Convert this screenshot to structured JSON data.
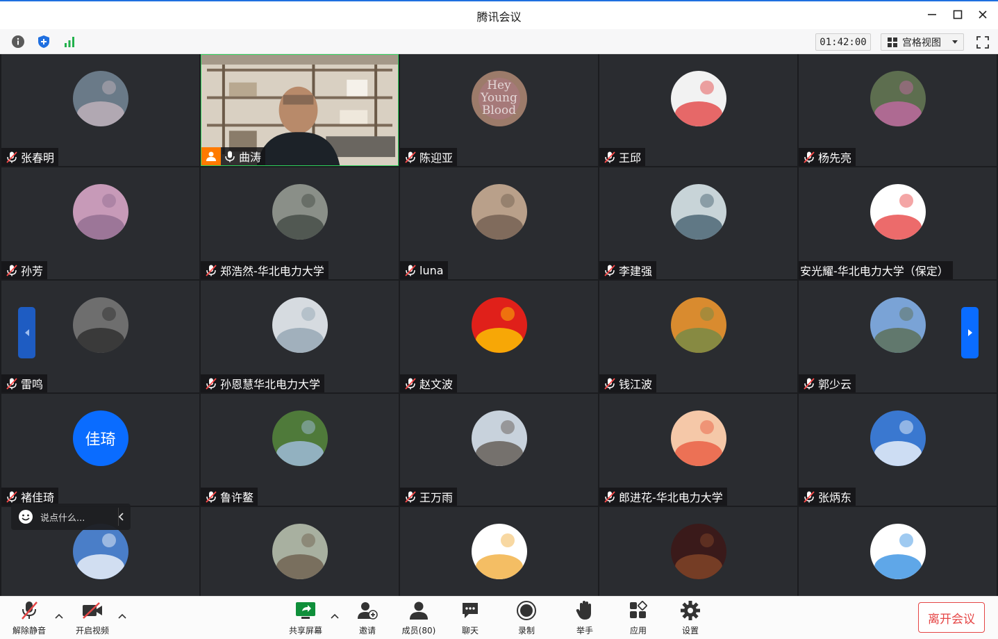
{
  "window": {
    "title": "腾讯会议"
  },
  "infobar": {
    "timer": "01:42:00",
    "view_mode": "宫格视图"
  },
  "participants": [
    {
      "name": "张春明",
      "avatar_bg": "#6a7a88",
      "avatar_accent": "#c9b8c0"
    },
    {
      "name": "曲涛",
      "video": true,
      "host": true
    },
    {
      "name": "陈迎亚",
      "avatar_bg": "#9c7b6a",
      "avatar_text": "Hey Young Blood"
    },
    {
      "name": "王邱",
      "avatar_bg": "#f2f2f2",
      "avatar_accent": "#e23a3a"
    },
    {
      "name": "杨先亮",
      "avatar_bg": "#5d6e4f",
      "avatar_accent": "#c96aa8"
    },
    {
      "name": "孙芳",
      "avatar_bg": "#c79ab8",
      "avatar_accent": "#8e6a8e"
    },
    {
      "name": "郑浩然-华北电力大学",
      "avatar_bg": "#8a8f88",
      "avatar_accent": "#3d4640"
    },
    {
      "name": "luna",
      "avatar_bg": "#b9a08a",
      "avatar_accent": "#6d5a4c"
    },
    {
      "name": "李建强",
      "avatar_bg": "#c8d4d8",
      "avatar_accent": "#3d5a6a"
    },
    {
      "name": "安光耀-华北电力大学（保定）",
      "avatar_bg": "#ffffff",
      "avatar_accent": "#e63a3a",
      "no_mic": true
    },
    {
      "name": "雷鸣",
      "avatar_bg": "#6e6e6e",
      "avatar_accent": "#2a2a2a"
    },
    {
      "name": "孙恩慧华北电力大学",
      "avatar_bg": "#d6dbe0",
      "avatar_accent": "#8fa2b0"
    },
    {
      "name": "赵文波",
      "avatar_bg": "#e0201a",
      "avatar_accent": "#ffd400"
    },
    {
      "name": "钱江波",
      "avatar_bg": "#d98b2f",
      "avatar_accent": "#6b8a4a"
    },
    {
      "name": "郭少云",
      "avatar_bg": "#7aa3d6",
      "avatar_accent": "#5a6a4a"
    },
    {
      "name": "褚佳琦",
      "avatar_label": "佳琦"
    },
    {
      "name": "鲁许鳌",
      "avatar_bg": "#4f7a3a",
      "avatar_accent": "#a8c4ee"
    },
    {
      "name": "王万雨",
      "avatar_bg": "#c8d2dc",
      "avatar_accent": "#5a5048"
    },
    {
      "name": "郎进花-华北电力大学",
      "avatar_bg": "#f5c8a8",
      "avatar_accent": "#e8543a"
    },
    {
      "name": "张炳东",
      "avatar_bg": "#3a78d0",
      "avatar_accent": "#ffffff"
    },
    {
      "name": "",
      "avatar_bg": "#4a7ec8",
      "avatar_accent": "#ffffff",
      "hidden_name": true
    },
    {
      "name": "",
      "avatar_bg": "#a8b0a0",
      "avatar_accent": "#6a5a48",
      "hidden_name": true
    },
    {
      "name": "",
      "avatar_bg": "#ffffff",
      "avatar_accent": "#f0a830",
      "hidden_name": true
    },
    {
      "name": "",
      "avatar_bg": "#3a1a1a",
      "avatar_accent": "#8a4a2a",
      "hidden_name": true
    },
    {
      "name": "",
      "avatar_bg": "#ffffff",
      "avatar_accent": "#2a8ae0",
      "hidden_name": true
    }
  ],
  "chat": {
    "placeholder": "说点什么..."
  },
  "toolbar": {
    "unmute": "解除静音",
    "start_video": "开启视频",
    "share_screen": "共享屏幕",
    "invite": "邀请",
    "members": "成员(80)",
    "chat": "聊天",
    "record": "录制",
    "raise_hand": "举手",
    "apps": "应用",
    "settings": "设置",
    "leave": "离开会议"
  },
  "colors": {
    "accent": "#0a6cff",
    "leave": "#e54545",
    "host_badge": "#ff7a00",
    "video_border": "#2fd05b"
  }
}
